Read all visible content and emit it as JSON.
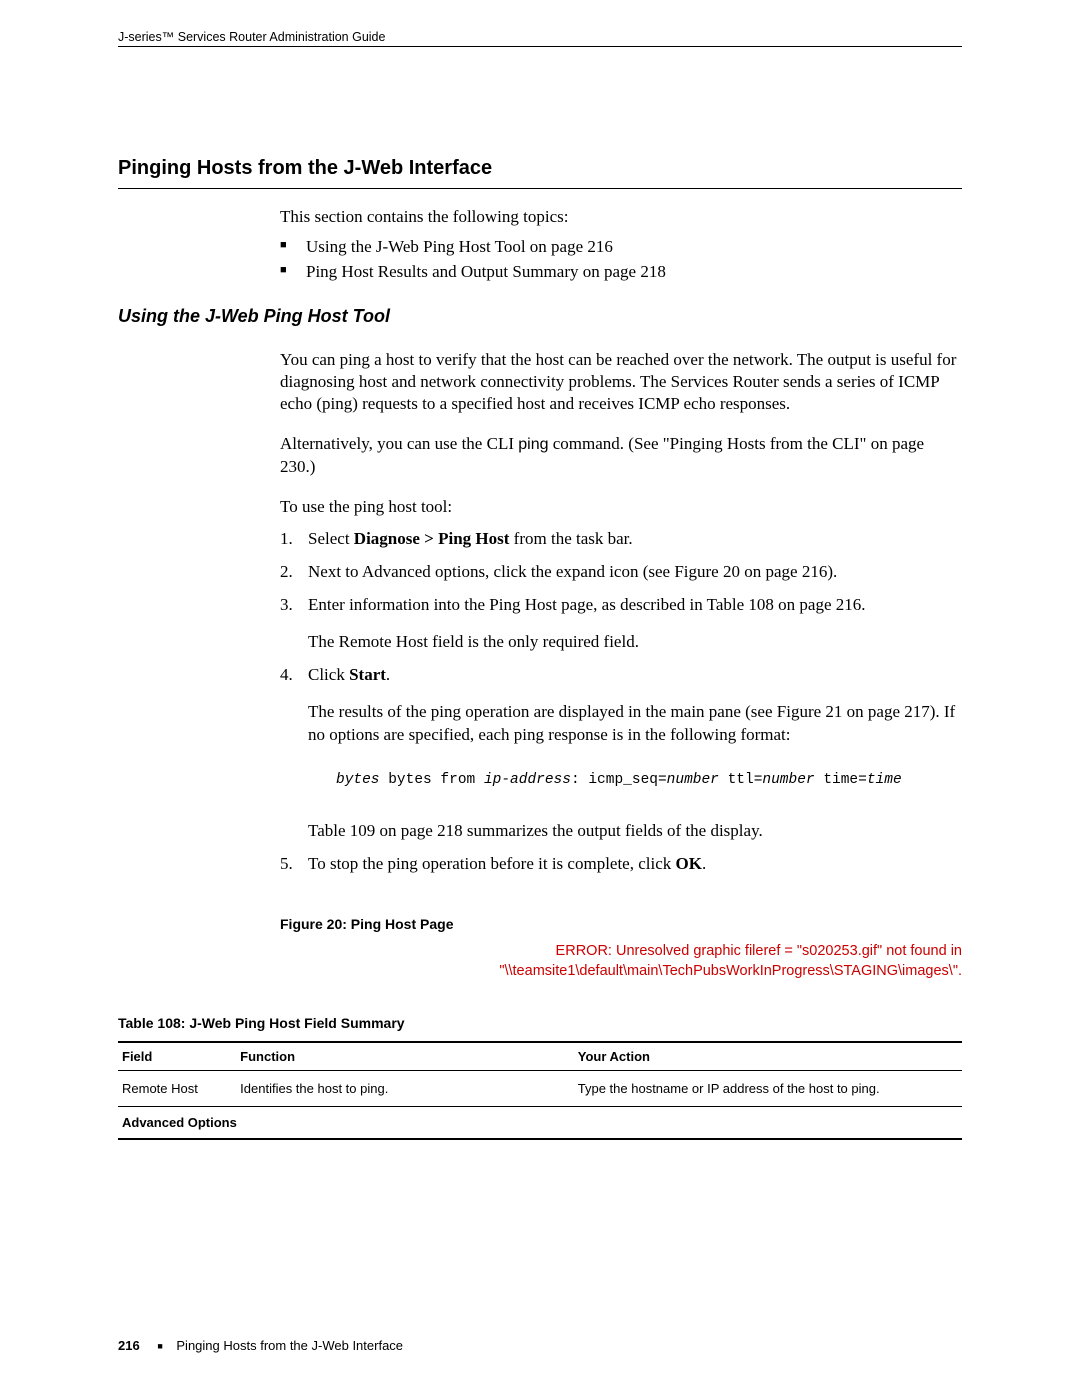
{
  "header": {
    "doc_title": "J-series™ Services Router Administration Guide"
  },
  "section": {
    "heading": "Pinging Hosts from the J-Web Interface",
    "intro": "This section contains the following topics:",
    "topics": [
      "Using the J-Web Ping Host Tool on page 216",
      "Ping Host Results and Output Summary on page 218"
    ]
  },
  "subsection": {
    "heading": "Using the J-Web Ping Host Tool",
    "para1": "You can ping a host to verify that the host can be reached over the network. The output is useful for diagnosing host and network connectivity problems. The Services Router sends a series of ICMP echo (ping) requests to a specified host and receives ICMP echo responses.",
    "para2_pre": "Alternatively, you can use the CLI ",
    "para2_cmd": "ping",
    "para2_post": " command. (See \"Pinging Hosts from the CLI\" on page 230.)",
    "para3": "To use the ping host tool:",
    "steps": {
      "s1_pre": "Select ",
      "s1_bold": "Diagnose > Ping Host",
      "s1_post": " from the task bar.",
      "s2": "Next to Advanced options, click the expand icon (see Figure 20 on page 216).",
      "s3": "Enter information into the Ping Host page, as described in Table 108 on page 216.",
      "s3_sub": "The Remote Host field is the only required field.",
      "s4_pre": "Click ",
      "s4_bold": "Start",
      "s4_post": ".",
      "s4_sub": "The results of the ping operation are displayed in the main pane (see Figure 21 on page 217). If no options are specified, each ping response is in the following format:",
      "code": {
        "bytes_i": "bytes",
        "bytes_t": " bytes from ",
        "ip_i": "ip-address",
        "colon": ": icmp_seq=",
        "num1_i": "number",
        "ttl": " ttl=",
        "num2_i": "number",
        "time": " time=",
        "time_i": "time"
      },
      "s4_sub2": "Table 109 on page 218 summarizes the output fields of the display.",
      "s5_pre": "To stop the ping operation before it is complete, click ",
      "s5_bold": "OK",
      "s5_post": "."
    }
  },
  "figure": {
    "caption": "Figure 20: Ping Host Page",
    "error_l1": "ERROR: Unresolved graphic fileref = \"s020253.gif\" not found in",
    "error_l2": "\"\\\\teamsite1\\default\\main\\TechPubsWorkInProgress\\STAGING\\images\\\"."
  },
  "table": {
    "caption": "Table 108: J-Web Ping Host Field Summary",
    "headers": {
      "field": "Field",
      "function": "Function",
      "action": "Your Action"
    },
    "rows": [
      {
        "field": "Remote Host",
        "function": "Identifies the host to ping.",
        "action": "Type the hostname or IP address of the host to ping."
      }
    ],
    "section_row": "Advanced Options"
  },
  "footer": {
    "page_number": "216",
    "title": "Pinging Hosts from the J-Web Interface"
  }
}
